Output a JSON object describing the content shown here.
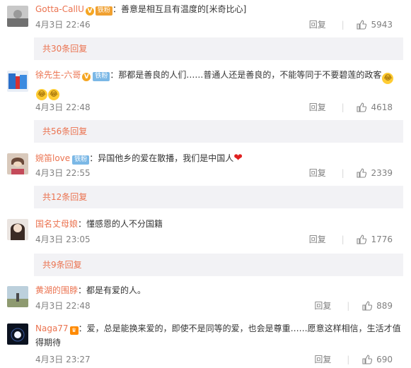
{
  "comments": [
    {
      "username": "Gotta-CallU",
      "badges": [
        "V",
        "铁粉"
      ],
      "text": "善意是相互且有温度的[米奇比心]",
      "time": "4月3日 22:46",
      "reply_label": "回复",
      "likes": "5943",
      "replies_label": "共30条回复"
    },
    {
      "username": "徐先生-六哥",
      "badges": [
        "V",
        "铁粉"
      ],
      "text": "那都是善良的人们……普通人还是善良的，不能等同于不要碧莲的政客",
      "time": "4月3日 22:48",
      "reply_label": "回复",
      "likes": "4618",
      "replies_label": "共56条回复"
    },
    {
      "username": "婉笛love",
      "badges": [
        "铁粉"
      ],
      "text": "异国他乡的爱在散播，我们是中国人",
      "time": "4月3日 22:55",
      "reply_label": "回复",
      "likes": "2339",
      "replies_label": "共12条回复"
    },
    {
      "username": "国名丈母娘",
      "text": "懂感恩的人不分国籍",
      "time": "4月3日 23:05",
      "reply_label": "回复",
      "likes": "1776",
      "replies_label": "共9条回复"
    },
    {
      "username": "黄湖的围脖",
      "text": "都是有爱的人。",
      "time": "4月3日 22:48",
      "reply_label": "回复",
      "likes": "889"
    },
    {
      "username": "Naga77",
      "text": "爱，总是能换来爱的，即使不是同等的爱，也会是尊重……愿意这样相信，生活才值得期待",
      "time": "4月3日 23:27",
      "reply_label": "回复",
      "likes": "690"
    }
  ],
  "colors": {
    "accent": "#eb7350",
    "meta": "#808080",
    "bar": "#f2f2f5"
  }
}
